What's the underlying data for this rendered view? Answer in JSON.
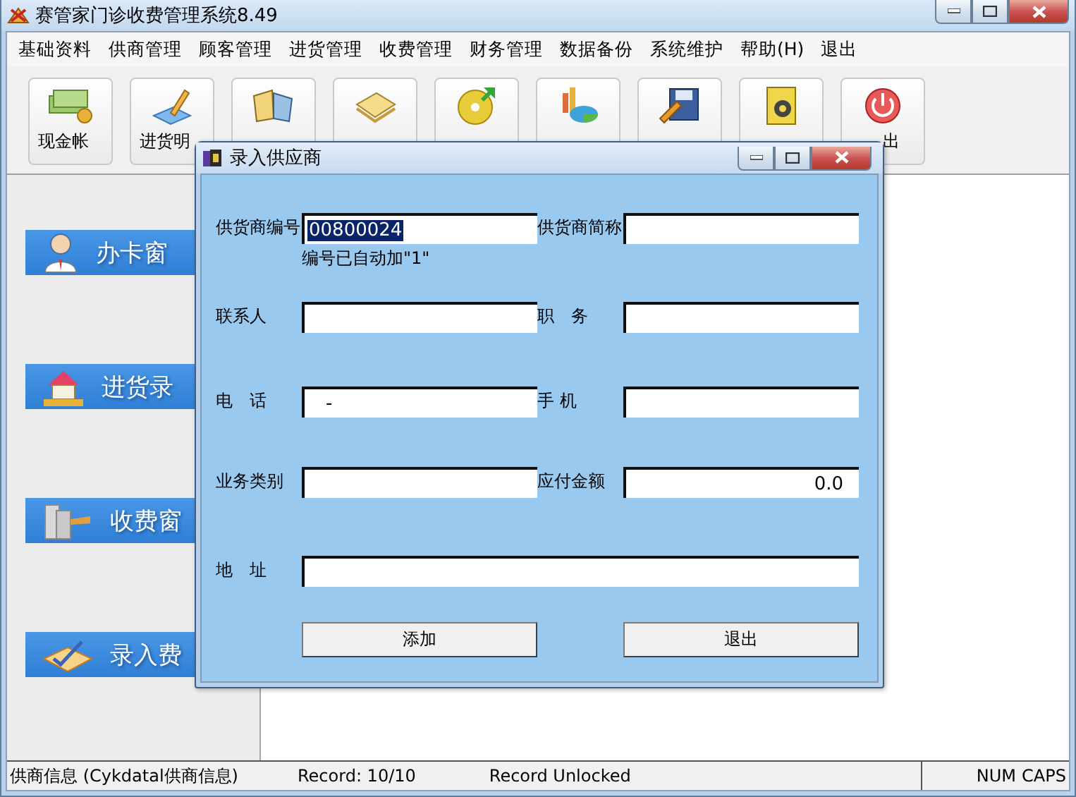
{
  "window": {
    "title": "赛管家门诊收费管理系统8.49"
  },
  "menu": [
    {
      "label": "基础资料"
    },
    {
      "label": "供商管理"
    },
    {
      "label": "顾客管理"
    },
    {
      "label": "进货管理"
    },
    {
      "label": "收费管理"
    },
    {
      "label": "财务管理"
    },
    {
      "label": "数据备份"
    },
    {
      "label": "系统维护"
    },
    {
      "label": "帮助(H)"
    },
    {
      "label": "退出"
    }
  ],
  "toolbar": [
    {
      "kind": "labeled",
      "label": "现金帐"
    },
    {
      "kind": "labeled",
      "label": "进货明"
    },
    {
      "kind": "icon_only"
    },
    {
      "kind": "icon_only"
    },
    {
      "kind": "icon_only"
    },
    {
      "kind": "icon_only"
    },
    {
      "kind": "icon_only"
    },
    {
      "kind": "icon_only"
    },
    {
      "kind": "labeled",
      "label": "出"
    }
  ],
  "nav": [
    {
      "label": "办卡窗"
    },
    {
      "label": "进货录"
    },
    {
      "label": "收费窗"
    },
    {
      "label": "录入费"
    }
  ],
  "dialog": {
    "title": "录入供应商",
    "fields": [
      {
        "label": "供货商编号",
        "value": "00800024",
        "value_selected": true
      },
      {
        "label": "供货商简称"
      },
      {
        "label": "联系人"
      },
      {
        "label": "职　务"
      },
      {
        "label": "电　话",
        "value": "-"
      },
      {
        "label": "手 机"
      },
      {
        "label": "业务类别"
      },
      {
        "label": "应付金额",
        "value": "0.0",
        "kind": "amount"
      },
      {
        "label": "地　址",
        "kind": "wide"
      }
    ],
    "hint": "编号已自动加\"1\"",
    "buttons": [
      "添加",
      "退出"
    ]
  },
  "status_bar": {
    "items": [
      "供商信息 (Cykdatal供商信息)",
      "Record: 10/10",
      "Record Unlocked"
    ],
    "indicators": [
      "NUM",
      "CAPS"
    ]
  }
}
